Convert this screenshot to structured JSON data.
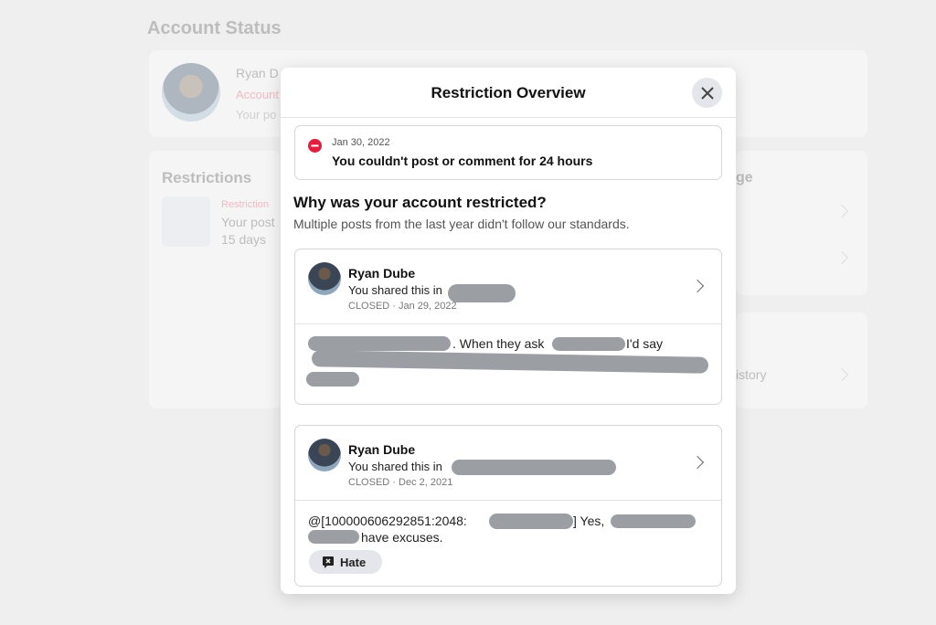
{
  "background": {
    "title": "Account Status",
    "profile_name": "Ryan D",
    "profile_status": "Account",
    "profile_sub": "Your po",
    "restrictions_title": "Restrictions",
    "restriction_label": "Restriction",
    "restriction_text": "Your post",
    "restriction_duration": "15 days",
    "right_title_fragment": "ge",
    "right_history_fragment": "istory"
  },
  "modal": {
    "title": "Restriction Overview",
    "alert": {
      "date": "Jan 30, 2022",
      "text": "You couldn't post or comment for 24 hours",
      "icon": "minus-circle-icon",
      "icon_color": "#e41e3f"
    },
    "why_title": "Why was your account restricted?",
    "why_sub": "Multiple posts from the last year didn't follow our standards.",
    "posts": [
      {
        "author": "Ryan Dube",
        "shared": "You shared this in",
        "meta": "CLOSED · Jan 29, 2022",
        "text_fragment_1": ". When they ask",
        "text_fragment_2": "I'd say"
      },
      {
        "author": "Ryan Dube",
        "shared": "You shared this in",
        "meta": "CLOSED · Dec 2, 2021",
        "text_fragment_1": "@[100000606292851:2048:",
        "text_fragment_2": "] Yes,",
        "text_fragment_3": "have excuses.",
        "tag": "Hate"
      }
    ]
  }
}
